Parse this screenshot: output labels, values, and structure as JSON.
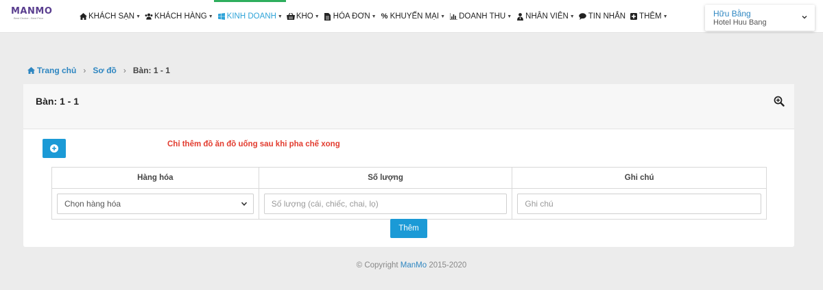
{
  "brand": {
    "logo": "MANMO",
    "tagline": "Best Choice - Best Price"
  },
  "nav": [
    {
      "label": "KHÁCH SẠN",
      "icon": "home-icon",
      "active": false
    },
    {
      "label": "KHÁCH HÀNG",
      "icon": "users-icon",
      "active": false
    },
    {
      "label": "KINH DOANH",
      "icon": "windows-icon",
      "active": true
    },
    {
      "label": "KHO",
      "icon": "basket-icon",
      "active": false
    },
    {
      "label": "HÓA ĐƠN",
      "icon": "file-icon",
      "active": false
    },
    {
      "label": "KHUYẾN MẠI",
      "icon": "percent-icon",
      "active": false
    },
    {
      "label": "DOANH THU",
      "icon": "bar-chart-icon",
      "active": false
    },
    {
      "label": "NHÂN VIÊN",
      "icon": "user-tie-icon",
      "active": false
    },
    {
      "label": "TIN NHẮN",
      "icon": "comment-icon",
      "active": false
    },
    {
      "label": "THÊM",
      "icon": "plus-square-icon",
      "active": false
    }
  ],
  "user": {
    "name": "Hữu Bằng",
    "hotel": "Hotel Huu Bang"
  },
  "breadcrumb": {
    "home": "Trang chủ",
    "map": "Sơ đồ",
    "current": "Bàn: 1 - 1"
  },
  "card": {
    "title": "Bàn: 1 - 1",
    "notice": "Chỉ thêm đồ ăn đồ uống sau khi pha chế xong",
    "columns": {
      "product": "Hàng hóa",
      "quantity": "Số lượng",
      "note": "Ghi chú"
    },
    "product_select": "Chọn hàng hóa",
    "quantity_placeholder": "Số lượng (cái, chiếc, chai, lọ)",
    "note_placeholder": "Ghi chú",
    "submit": "Thêm"
  },
  "footer": {
    "prefix": "© Copyright ",
    "brand": "ManMo",
    "years": " 2015-2020"
  },
  "colors": {
    "accent": "#1b9ad6",
    "active_bar": "#2fae5e",
    "notice": "#e23b2e",
    "link": "#2e86c1"
  }
}
